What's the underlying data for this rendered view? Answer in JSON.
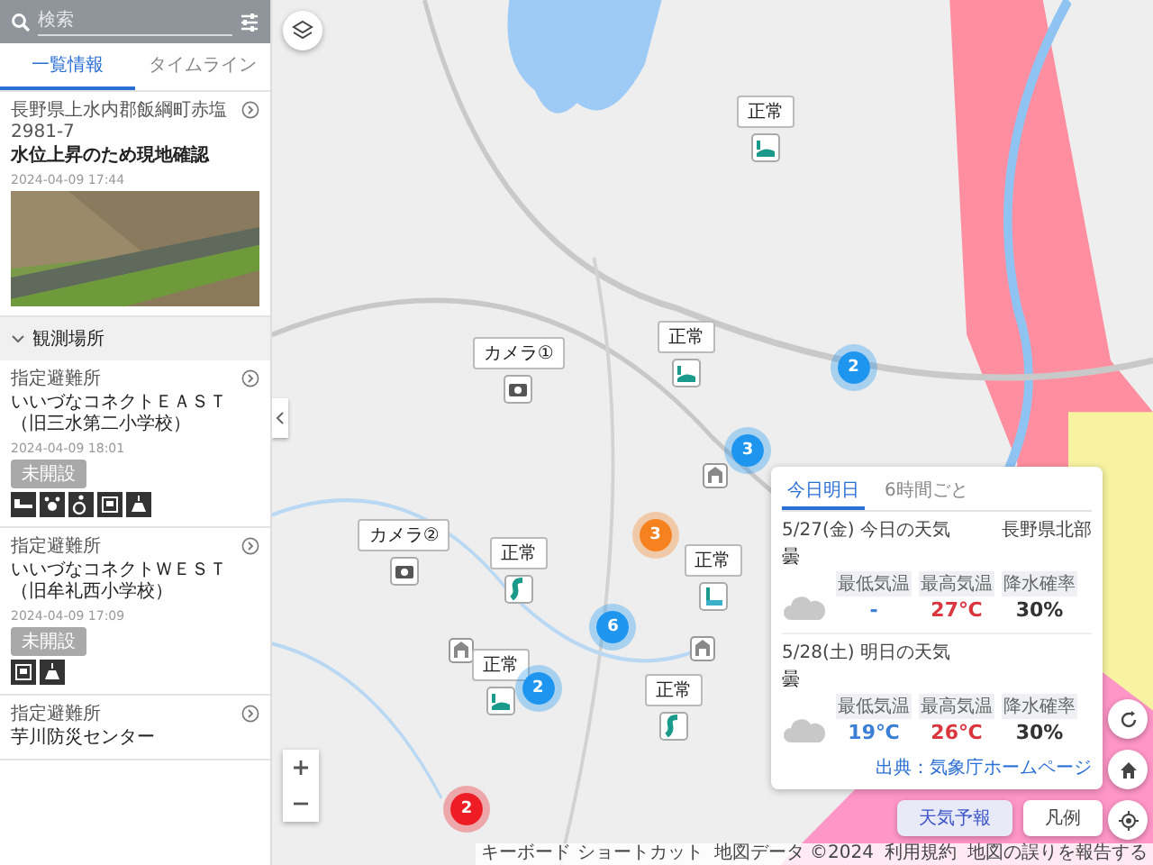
{
  "search": {
    "placeholder": "検索"
  },
  "tabs": [
    {
      "label": "一覧情報",
      "selected": true
    },
    {
      "label": "タイムライン",
      "selected": false
    }
  ],
  "report": {
    "address": "長野県上水内郡飯綱町赤塩2981-7",
    "title": "水位上昇のため現地確認",
    "time": "2024-04-09 17:44"
  },
  "section": {
    "label": "観測場所",
    "expanded": true
  },
  "places": [
    {
      "category": "指定避難所",
      "name": "いいづなコネクトＥＡＳＴ（旧三水第二小学校）",
      "time": "2024-04-09 18:01",
      "status": "未開設",
      "facilities": [
        {
          "kind": "bed"
        },
        {
          "kind": "pet"
        },
        {
          "kind": "wheelchair"
        },
        {
          "kind": "parking"
        },
        {
          "kind": "heater"
        }
      ]
    },
    {
      "category": "指定避難所",
      "name": "いいづなコネクトＷＥＳＴ（旧牟礼西小学校）",
      "time": "2024-04-09 17:09",
      "status": "未開設",
      "facilities": [
        {
          "kind": "parking"
        },
        {
          "kind": "heater"
        }
      ]
    },
    {
      "category": "指定避難所",
      "name": "芋川防災センター"
    }
  ],
  "map": {
    "markers": [
      {
        "kind": "water",
        "label": "正常"
      },
      {
        "kind": "water",
        "label": "正常"
      },
      {
        "kind": "camera",
        "label": "カメラ①"
      },
      {
        "kind": "camera",
        "label": "カメラ②"
      },
      {
        "kind": "river",
        "label": "正常"
      },
      {
        "kind": "gauge",
        "label": "正常"
      },
      {
        "kind": "water",
        "label": "正常"
      },
      {
        "kind": "river",
        "label": "正常"
      }
    ],
    "clusters": [
      {
        "count": "2",
        "color": "#1e96f0"
      },
      {
        "count": "3",
        "color": "#1e96f0"
      },
      {
        "count": "3",
        "color": "#f5821f"
      },
      {
        "count": "6",
        "color": "#1e96f0"
      },
      {
        "count": "2",
        "color": "#1e96f0"
      },
      {
        "count": "2",
        "color": "#ee1c25"
      }
    ]
  },
  "weather": {
    "tabs": [
      {
        "label": "今日明日",
        "selected": true
      },
      {
        "label": "6時間ごと",
        "selected": false
      }
    ],
    "days": [
      {
        "date": "5/27(金) 今日の天気",
        "region": "長野県北部",
        "weather": "曇",
        "stats": [
          {
            "kind": "min",
            "label": "最低気温",
            "value": "-"
          },
          {
            "kind": "max",
            "label": "最高気温",
            "value": "27℃"
          },
          {
            "kind": "rain",
            "label": "降水確率",
            "value": "30%"
          }
        ]
      },
      {
        "date": "5/28(土) 明日の天気",
        "weather": "曇",
        "stats": [
          {
            "kind": "min",
            "label": "最低気温",
            "value": "19℃"
          },
          {
            "kind": "max",
            "label": "最高気温",
            "value": "26℃"
          },
          {
            "kind": "rain",
            "label": "降水確率",
            "value": "30%"
          }
        ]
      }
    ],
    "source": "出典：気象庁ホームページ"
  },
  "map_buttons": [
    {
      "label": "天気予報",
      "selected": true
    },
    {
      "label": "凡例",
      "selected": false
    }
  ],
  "attribution": [
    "キーボード ショートカット",
    "地図データ ©2024",
    "利用規約",
    "地図の誤りを報告する"
  ]
}
